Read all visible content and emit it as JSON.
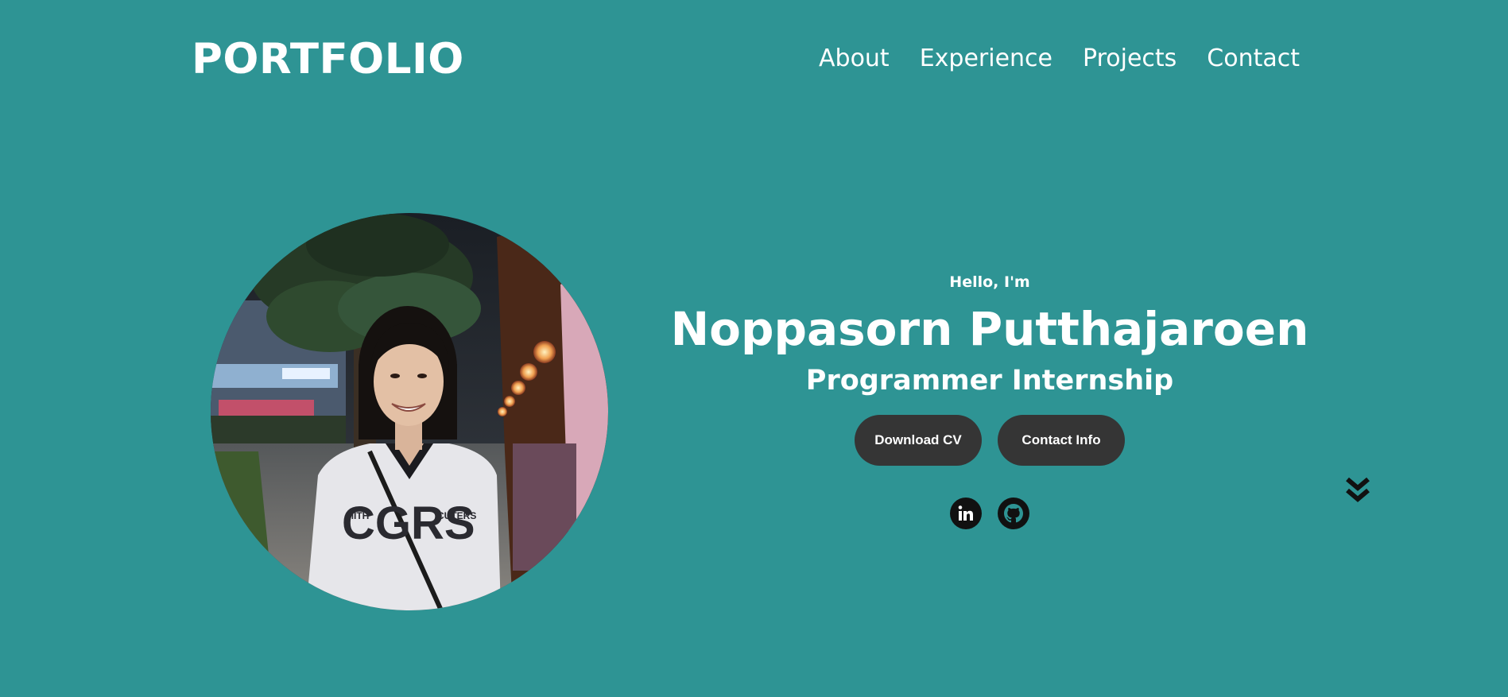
{
  "header": {
    "logo": "PORTFOLIO",
    "nav": [
      {
        "label": "About"
      },
      {
        "label": "Experience"
      },
      {
        "label": "Projects"
      },
      {
        "label": "Contact"
      }
    ]
  },
  "hero": {
    "greeting": "Hello, I'm",
    "name": "Noppasorn Putthajaroen",
    "role": "Programmer Internship",
    "buttons": {
      "download_cv": "Download CV",
      "contact_info": "Contact Info"
    },
    "socials": [
      {
        "icon": "linkedin-icon"
      },
      {
        "icon": "github-icon"
      }
    ],
    "scroll_icon": "double-chevron-down-icon"
  },
  "colors": {
    "background": "#2e9494",
    "text": "#ffffff",
    "button": "#353535",
    "icon": "#111111"
  }
}
